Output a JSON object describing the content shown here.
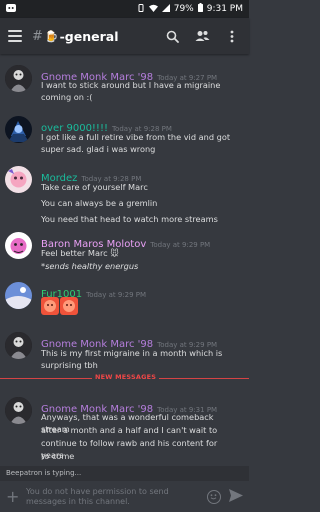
{
  "status_bar": {
    "time": "9:31 PM",
    "battery": "79%"
  },
  "channel": {
    "hash": "#",
    "emoji": "🍺",
    "name": "-general"
  },
  "messages": [
    {
      "author": "Gnome Monk Marc '98",
      "author_color": "#b57edc",
      "timestamp": "Today at 9:27 PM",
      "lines": [
        "I want to stick around but I have a migraine",
        "coming on :("
      ]
    },
    {
      "author": "over 9000!!!!",
      "author_color": "#1abc9c",
      "timestamp": "Today at 9:28 PM",
      "lines": [
        "I got like a full retire vibe from the vid and got",
        "super sad. glad i was wrong"
      ]
    },
    {
      "author": "Mordez",
      "author_color": "#1abc9c",
      "timestamp": "Today at 9:28 PM",
      "lines": [
        "Take care of yourself Marc",
        "You can always be a gremlin",
        "You need that head to watch more streams"
      ]
    },
    {
      "author": "Baron Maros Molotov",
      "author_color": "#e9a0f5",
      "timestamp": "Today at 9:29 PM",
      "lines": [
        "Feel better Marc 🐭",
        "*sends healthy energus"
      ]
    },
    {
      "author": "Fur1001",
      "author_color": "#2ecc71",
      "timestamp": "Today at 9:29 PM",
      "lines": []
    },
    {
      "author": "Gnome Monk Marc '98",
      "author_color": "#b57edc",
      "timestamp": "Today at 9:29 PM",
      "lines": [
        "This is my first migraine in a month which is",
        "surprising tbh"
      ]
    },
    {
      "author": "Gnome Monk Marc '98",
      "author_color": "#b57edc",
      "timestamp": "Today at 9:31 PM",
      "lines": [
        "Anyways, that was a wonderful comeback stream",
        "after a month and a half and I can't wait to",
        "continue to follow rawb and his content for years",
        "to come"
      ]
    }
  ],
  "new_messages_label": "NEW MESSAGES",
  "typing_indicator": "Beepatron is typing...",
  "input": {
    "permission_text": "You do not have permission to send messages in this channel."
  },
  "colors": {
    "background": "#36393f",
    "header": "#2f3136",
    "new_messages": "#f04747"
  },
  "icons": [
    "discord-icon",
    "vibrate-icon",
    "wifi-icon",
    "signal-icon",
    "battery-icon",
    "hamburger-menu-icon",
    "search-icon",
    "members-icon",
    "more-vert-icon",
    "plus-icon",
    "emoji-icon",
    "send-icon"
  ]
}
